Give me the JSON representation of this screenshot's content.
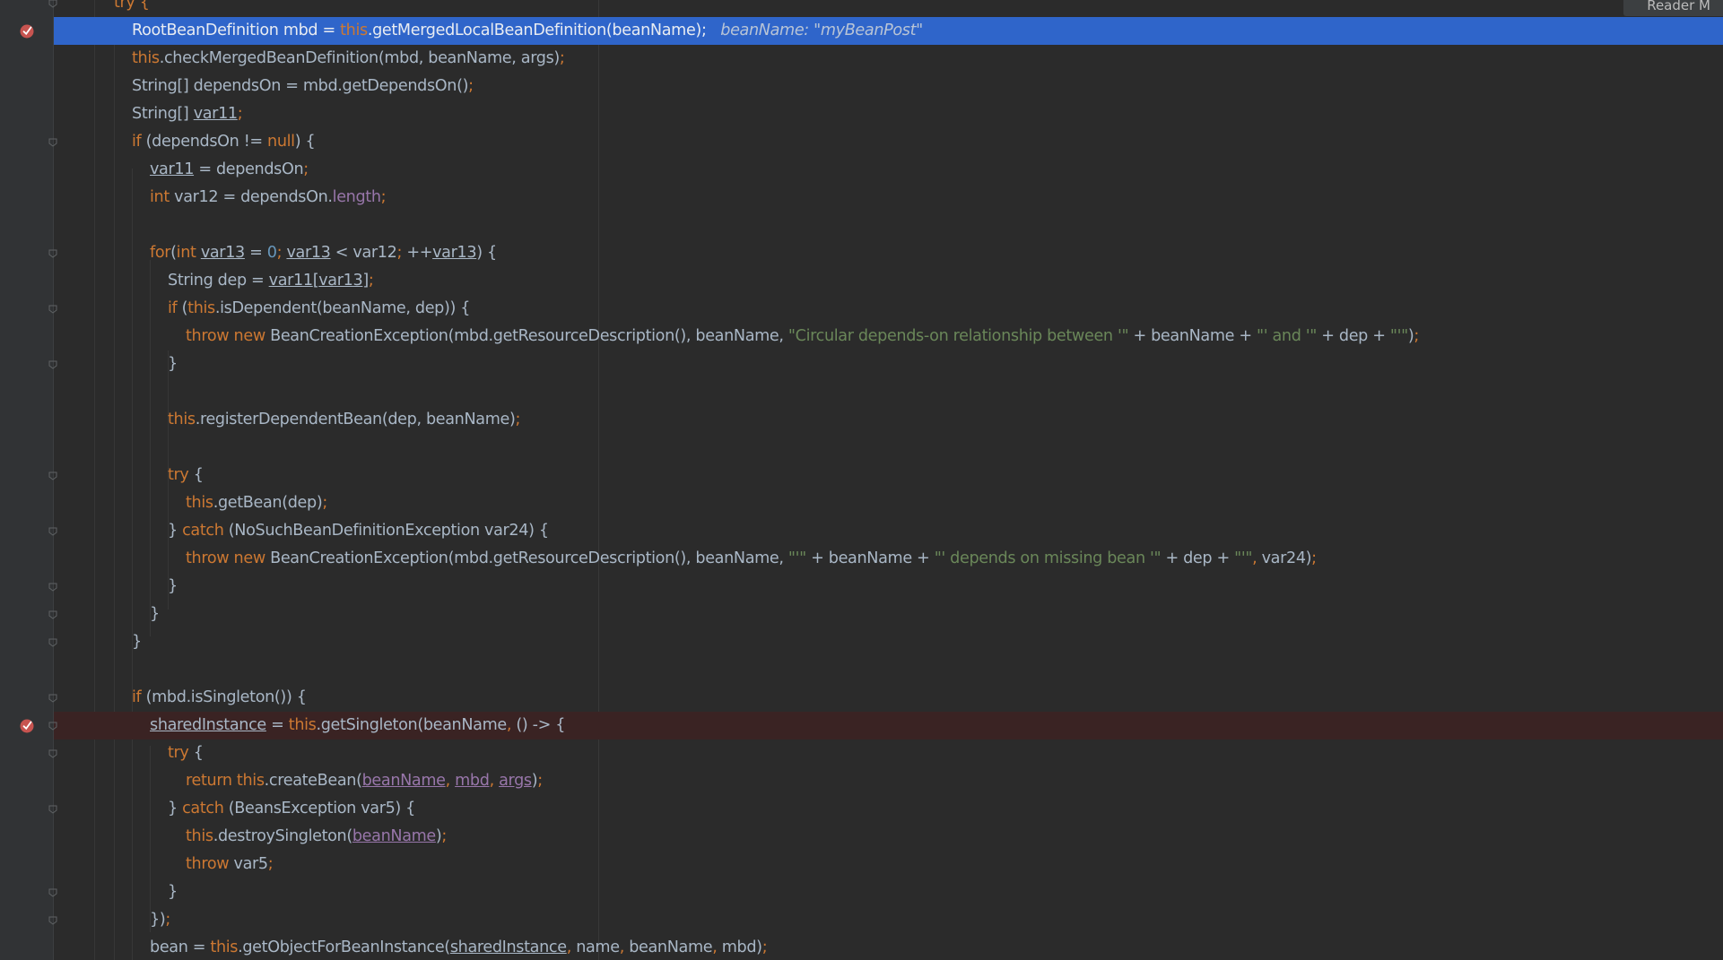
{
  "reader_mode_label": "Reader M",
  "colors": {
    "background": "#2b2b2b",
    "execution_line": "#2f65ca",
    "breakpoint_line": "#3a2323",
    "breakpoint": "#c75450",
    "keyword": "#cc7832",
    "string": "#6a8759",
    "number": "#6897bb",
    "field": "#9876aa",
    "default_text": "#a9b7c6"
  },
  "breakpoints": [
    {
      "line": 1,
      "icon": "breakpoint-verified-icon"
    },
    {
      "line": 26,
      "icon": "breakpoint-verified-icon"
    }
  ],
  "lines": [
    {
      "indent": 3,
      "parts": [
        {
          "t": "try {",
          "c": "k"
        }
      ]
    },
    {
      "indent": 4,
      "mark": "exec",
      "parts": [
        {
          "t": "RootBeanDefinition mbd = "
        },
        {
          "t": "this",
          "c": "k"
        },
        {
          "t": ".getMergedLocalBeanDefinition(beanName);"
        },
        {
          "t": "   beanName: \"myBeanPost\"",
          "c": "h"
        }
      ]
    },
    {
      "indent": 4,
      "parts": [
        {
          "t": "this",
          "c": "k"
        },
        {
          "t": ".checkMergedBeanDefinition(mbd, beanName, args)"
        },
        {
          "t": ";",
          "c": "k"
        }
      ]
    },
    {
      "indent": 4,
      "parts": [
        {
          "t": "String[] dependsOn = mbd.getDependsOn()"
        },
        {
          "t": ";",
          "c": "k"
        }
      ]
    },
    {
      "indent": 4,
      "parts": [
        {
          "t": "String[] "
        },
        {
          "t": "var11",
          "c": "u"
        },
        {
          "t": ";",
          "c": "k"
        }
      ]
    },
    {
      "indent": 4,
      "parts": [
        {
          "t": "if ",
          "c": "k"
        },
        {
          "t": "(dependsOn != "
        },
        {
          "t": "null",
          "c": "k"
        },
        {
          "t": ") {"
        }
      ]
    },
    {
      "indent": 5,
      "parts": [
        {
          "t": "var11",
          "c": "u"
        },
        {
          "t": " = dependsOn"
        },
        {
          "t": ";",
          "c": "k"
        }
      ]
    },
    {
      "indent": 5,
      "parts": [
        {
          "t": "int ",
          "c": "k"
        },
        {
          "t": "var12 = dependsOn."
        },
        {
          "t": "length",
          "c": "f"
        },
        {
          "t": ";",
          "c": "k"
        }
      ]
    },
    {
      "indent": 5,
      "parts": []
    },
    {
      "indent": 5,
      "parts": [
        {
          "t": "for",
          "c": "k"
        },
        {
          "t": "("
        },
        {
          "t": "int ",
          "c": "k"
        },
        {
          "t": "var13",
          "c": "u"
        },
        {
          "t": " = "
        },
        {
          "t": "0",
          "c": "n"
        },
        {
          "t": "; ",
          "c": "k"
        },
        {
          "t": "var13",
          "c": "u"
        },
        {
          "t": " < var12"
        },
        {
          "t": "; ",
          "c": "k"
        },
        {
          "t": "++"
        },
        {
          "t": "var13",
          "c": "u"
        },
        {
          "t": ") {"
        }
      ]
    },
    {
      "indent": 6,
      "parts": [
        {
          "t": "String dep = "
        },
        {
          "t": "var11",
          "c": "u"
        },
        {
          "t": "[",
          "c": "u"
        },
        {
          "t": "var13",
          "c": "u"
        },
        {
          "t": "]",
          "c": "u"
        },
        {
          "t": ";",
          "c": "k"
        }
      ]
    },
    {
      "indent": 6,
      "parts": [
        {
          "t": "if ",
          "c": "k"
        },
        {
          "t": "("
        },
        {
          "t": "this",
          "c": "k"
        },
        {
          "t": ".isDependent(beanName, dep)) {"
        }
      ]
    },
    {
      "indent": 7,
      "parts": [
        {
          "t": "throw new ",
          "c": "k"
        },
        {
          "t": "BeanCreationException(mbd.getResourceDescription(), beanName, "
        },
        {
          "t": "\"Circular depends-on relationship between '\"",
          "c": "s"
        },
        {
          "t": " + beanName + "
        },
        {
          "t": "\"' and '\"",
          "c": "s"
        },
        {
          "t": " + dep + "
        },
        {
          "t": "\"'\"",
          "c": "s"
        },
        {
          "t": ")"
        },
        {
          "t": ";",
          "c": "k"
        }
      ]
    },
    {
      "indent": 6,
      "parts": [
        {
          "t": "}"
        }
      ]
    },
    {
      "indent": 6,
      "parts": []
    },
    {
      "indent": 6,
      "parts": [
        {
          "t": "this",
          "c": "k"
        },
        {
          "t": ".registerDependentBean(dep, beanName)"
        },
        {
          "t": ";",
          "c": "k"
        }
      ]
    },
    {
      "indent": 6,
      "parts": []
    },
    {
      "indent": 6,
      "parts": [
        {
          "t": "try ",
          "c": "k"
        },
        {
          "t": "{"
        }
      ]
    },
    {
      "indent": 7,
      "parts": [
        {
          "t": "this",
          "c": "k"
        },
        {
          "t": ".getBean(dep)"
        },
        {
          "t": ";",
          "c": "k"
        }
      ]
    },
    {
      "indent": 6,
      "parts": [
        {
          "t": "} "
        },
        {
          "t": "catch ",
          "c": "k"
        },
        {
          "t": "(NoSuchBeanDefinitionException var24) {"
        }
      ]
    },
    {
      "indent": 7,
      "parts": [
        {
          "t": "throw new ",
          "c": "k"
        },
        {
          "t": "BeanCreationException(mbd.getResourceDescription(), beanName, "
        },
        {
          "t": "\"'\"",
          "c": "s"
        },
        {
          "t": " + beanName + "
        },
        {
          "t": "\"' depends on missing bean '\"",
          "c": "s"
        },
        {
          "t": " + dep + "
        },
        {
          "t": "\"'\"",
          "c": "s"
        },
        {
          "t": ", ",
          "c": "k"
        },
        {
          "t": "var24)"
        },
        {
          "t": ";",
          "c": "k"
        }
      ]
    },
    {
      "indent": 6,
      "parts": [
        {
          "t": "}"
        }
      ]
    },
    {
      "indent": 5,
      "parts": [
        {
          "t": "}"
        }
      ]
    },
    {
      "indent": 4,
      "parts": [
        {
          "t": "}"
        }
      ]
    },
    {
      "indent": 4,
      "parts": []
    },
    {
      "indent": 4,
      "parts": [
        {
          "t": "if ",
          "c": "k"
        },
        {
          "t": "(mbd.isSingleton()) {"
        }
      ]
    },
    {
      "indent": 5,
      "mark": "bp",
      "parts": [
        {
          "t": "sharedInstance",
          "c": "u"
        },
        {
          "t": " = "
        },
        {
          "t": "this",
          "c": "k"
        },
        {
          "t": ".getSingleton(beanName"
        },
        {
          "t": ", ",
          "c": "k"
        },
        {
          "t": "() -> {"
        }
      ]
    },
    {
      "indent": 6,
      "parts": [
        {
          "t": "try ",
          "c": "k"
        },
        {
          "t": "{"
        }
      ]
    },
    {
      "indent": 7,
      "parts": [
        {
          "t": "return this",
          "c": "k"
        },
        {
          "t": ".createBean("
        },
        {
          "t": "beanName",
          "c": "pu"
        },
        {
          "t": ", ",
          "c": "k"
        },
        {
          "t": "mbd",
          "c": "pu"
        },
        {
          "t": ", ",
          "c": "k"
        },
        {
          "t": "args",
          "c": "pu"
        },
        {
          "t": ")"
        },
        {
          "t": ";",
          "c": "k"
        }
      ]
    },
    {
      "indent": 6,
      "parts": [
        {
          "t": "} "
        },
        {
          "t": "catch ",
          "c": "k"
        },
        {
          "t": "(BeansException var5) {"
        }
      ]
    },
    {
      "indent": 7,
      "parts": [
        {
          "t": "this",
          "c": "k"
        },
        {
          "t": ".destroySingleton("
        },
        {
          "t": "beanName",
          "c": "pu"
        },
        {
          "t": ")"
        },
        {
          "t": ";",
          "c": "k"
        }
      ]
    },
    {
      "indent": 7,
      "parts": [
        {
          "t": "throw ",
          "c": "k"
        },
        {
          "t": "var5"
        },
        {
          "t": ";",
          "c": "k"
        }
      ]
    },
    {
      "indent": 6,
      "parts": [
        {
          "t": "}"
        }
      ]
    },
    {
      "indent": 5,
      "parts": [
        {
          "t": "})"
        },
        {
          "t": ";",
          "c": "k"
        }
      ]
    },
    {
      "indent": 5,
      "parts": [
        {
          "t": "bean = "
        },
        {
          "t": "this",
          "c": "k"
        },
        {
          "t": ".getObjectForBeanInstance("
        },
        {
          "t": "sharedInstance",
          "c": "u"
        },
        {
          "t": ", ",
          "c": "k"
        },
        {
          "t": "name"
        },
        {
          "t": ", ",
          "c": "k"
        },
        {
          "t": "beanName"
        },
        {
          "t": ", ",
          "c": "k"
        },
        {
          "t": "mbd)"
        },
        {
          "t": ";",
          "c": "k"
        }
      ]
    }
  ]
}
